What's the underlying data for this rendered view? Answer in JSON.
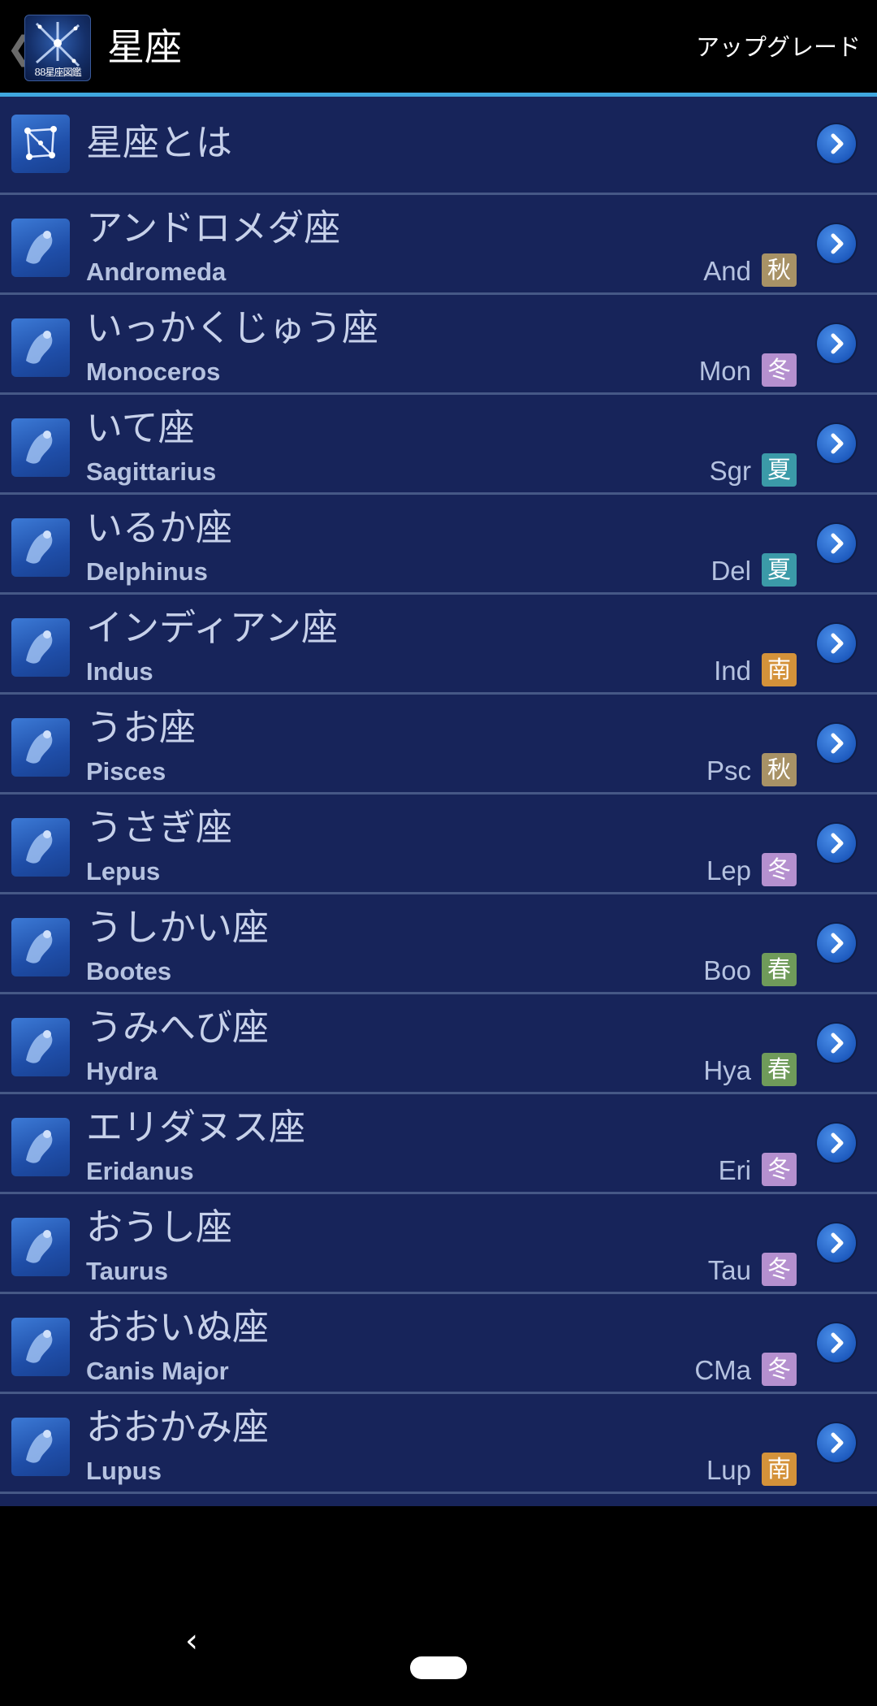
{
  "header": {
    "back_icon": "chevron-left-icon",
    "app_icon_caption": "88星座図鑑",
    "title": "星座",
    "upgrade_label": "アップグレード"
  },
  "colors": {
    "accent": "#3fa7df",
    "list_bg": "#17245a",
    "season_autumn": "#a89266",
    "season_winter": "#b590cf",
    "season_summer": "#3b9aa8",
    "season_south": "#d4923a",
    "season_spring": "#6f9b5a"
  },
  "intro_row": {
    "label": "星座とは",
    "icon": "constellation-icon"
  },
  "constellations": [
    {
      "jp": "アンドロメダ座",
      "en": "Andromeda",
      "abbr": "And",
      "season": "秋",
      "season_color": "#a89266",
      "icon": "andromeda-icon"
    },
    {
      "jp": "いっかくじゅう座",
      "en": "Monoceros",
      "abbr": "Mon",
      "season": "冬",
      "season_color": "#b590cf",
      "icon": "unicorn-icon"
    },
    {
      "jp": "いて座",
      "en": "Sagittarius",
      "abbr": "Sgr",
      "season": "夏",
      "season_color": "#3b9aa8",
      "icon": "archer-icon"
    },
    {
      "jp": "いるか座",
      "en": "Delphinus",
      "abbr": "Del",
      "season": "夏",
      "season_color": "#3b9aa8",
      "icon": "dolphin-icon"
    },
    {
      "jp": "インディアン座",
      "en": "Indus",
      "abbr": "Ind",
      "season": "南",
      "season_color": "#d4923a",
      "icon": "indian-icon"
    },
    {
      "jp": "うお座",
      "en": "Pisces",
      "abbr": "Psc",
      "season": "秋",
      "season_color": "#a89266",
      "icon": "fish-icon"
    },
    {
      "jp": "うさぎ座",
      "en": "Lepus",
      "abbr": "Lep",
      "season": "冬",
      "season_color": "#b590cf",
      "icon": "hare-icon"
    },
    {
      "jp": "うしかい座",
      "en": "Bootes",
      "abbr": "Boo",
      "season": "春",
      "season_color": "#6f9b5a",
      "icon": "herdsman-icon"
    },
    {
      "jp": "うみへび座",
      "en": "Hydra",
      "abbr": "Hya",
      "season": "春",
      "season_color": "#6f9b5a",
      "icon": "hydra-icon"
    },
    {
      "jp": "エリダヌス座",
      "en": "Eridanus",
      "abbr": "Eri",
      "season": "冬",
      "season_color": "#b590cf",
      "icon": "river-icon"
    },
    {
      "jp": "おうし座",
      "en": "Taurus",
      "abbr": "Tau",
      "season": "冬",
      "season_color": "#b590cf",
      "icon": "bull-icon"
    },
    {
      "jp": "おおいぬ座",
      "en": "Canis Major",
      "abbr": "CMa",
      "season": "冬",
      "season_color": "#b590cf",
      "icon": "great-dog-icon"
    },
    {
      "jp": "おおかみ座",
      "en": "Lupus",
      "abbr": "Lup",
      "season": "南",
      "season_color": "#d4923a",
      "icon": "wolf-icon"
    }
  ],
  "navbar": {
    "back_icon": "nav-back-icon",
    "home_icon": "nav-home-pill-icon"
  }
}
